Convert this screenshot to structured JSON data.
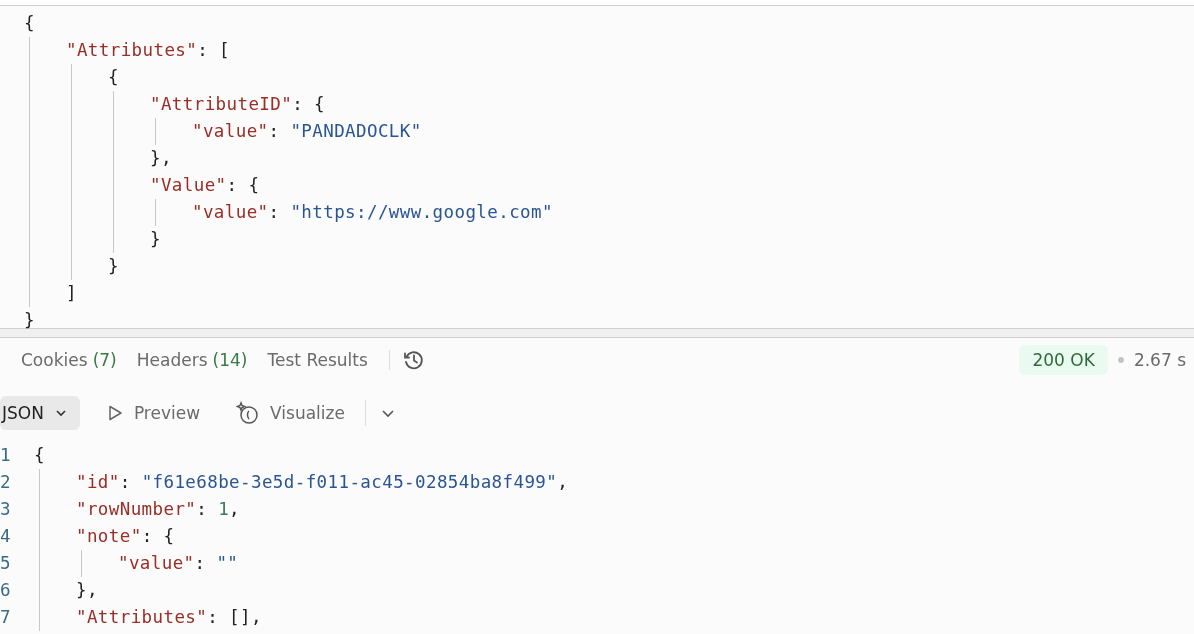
{
  "request_body": {
    "lines": [
      {
        "tokens": [
          {
            "kind": "punct",
            "text": "{"
          }
        ],
        "children": [
          {
            "tokens": [
              {
                "kind": "key",
                "text": "\"Attributes\""
              },
              {
                "kind": "punct",
                "text": ": ["
              }
            ],
            "children": [
              {
                "tokens": [
                  {
                    "kind": "punct",
                    "text": "{"
                  }
                ],
                "children": [
                  {
                    "tokens": [
                      {
                        "kind": "key",
                        "text": "\"AttributeID\""
                      },
                      {
                        "kind": "punct",
                        "text": ": {"
                      }
                    ],
                    "children": [
                      {
                        "tokens": [
                          {
                            "kind": "key",
                            "text": "\"value\""
                          },
                          {
                            "kind": "punct",
                            "text": ": "
                          },
                          {
                            "kind": "string",
                            "text": "\"PANDADOCLK\""
                          }
                        ]
                      }
                    ]
                  },
                  {
                    "tokens": [
                      {
                        "kind": "punct",
                        "text": "},"
                      }
                    ]
                  },
                  {
                    "tokens": [
                      {
                        "kind": "key",
                        "text": "\"Value\""
                      },
                      {
                        "kind": "punct",
                        "text": ": {"
                      }
                    ],
                    "children": [
                      {
                        "tokens": [
                          {
                            "kind": "key",
                            "text": "\"value\""
                          },
                          {
                            "kind": "punct",
                            "text": ": "
                          },
                          {
                            "kind": "string",
                            "text": "\"https://www.google.com\""
                          }
                        ]
                      }
                    ]
                  },
                  {
                    "tokens": [
                      {
                        "kind": "punct",
                        "text": "}"
                      }
                    ]
                  }
                ]
              },
              {
                "tokens": [
                  {
                    "kind": "punct",
                    "text": "}"
                  }
                ]
              }
            ]
          },
          {
            "tokens": [
              {
                "kind": "punct",
                "text": "]"
              }
            ]
          }
        ]
      },
      {
        "tokens": [
          {
            "kind": "punct",
            "text": "}"
          }
        ]
      }
    ]
  },
  "response_tabs": [
    {
      "label": "Cookies",
      "count": "(7)"
    },
    {
      "label": "Headers",
      "count": "(14)"
    },
    {
      "label": "Test Results"
    }
  ],
  "status": {
    "code": "200 OK",
    "time": "2.67 s"
  },
  "toolbar": {
    "format": "JSON",
    "preview": "Preview",
    "visualize": "Visualize"
  },
  "response_body": {
    "lines": [
      {
        "number": "1",
        "tokens": [
          {
            "kind": "punct",
            "text": "{"
          }
        ],
        "children": [
          {
            "number": "2",
            "tokens": [
              {
                "kind": "key",
                "text": "\"id\""
              },
              {
                "kind": "punct",
                "text": ": "
              },
              {
                "kind": "string",
                "text": "\"f61e68be-3e5d-f011-ac45-02854ba8f499\""
              },
              {
                "kind": "punct",
                "text": ","
              }
            ]
          },
          {
            "number": "3",
            "tokens": [
              {
                "kind": "key",
                "text": "\"rowNumber\""
              },
              {
                "kind": "punct",
                "text": ": "
              },
              {
                "kind": "number",
                "text": "1"
              },
              {
                "kind": "punct",
                "text": ","
              }
            ]
          },
          {
            "number": "4",
            "tokens": [
              {
                "kind": "key",
                "text": "\"note\""
              },
              {
                "kind": "punct",
                "text": ": {"
              }
            ],
            "children": [
              {
                "number": "5",
                "tokens": [
                  {
                    "kind": "key",
                    "text": "\"value\""
                  },
                  {
                    "kind": "punct",
                    "text": ": "
                  },
                  {
                    "kind": "string",
                    "text": "\"\""
                  }
                ]
              }
            ]
          },
          {
            "number": "6",
            "tokens": [
              {
                "kind": "punct",
                "text": "},"
              }
            ]
          },
          {
            "number": "7",
            "tokens": [
              {
                "kind": "key",
                "text": "\"Attributes\""
              },
              {
                "kind": "punct",
                "text": ": [],"
              }
            ]
          }
        ]
      }
    ]
  }
}
